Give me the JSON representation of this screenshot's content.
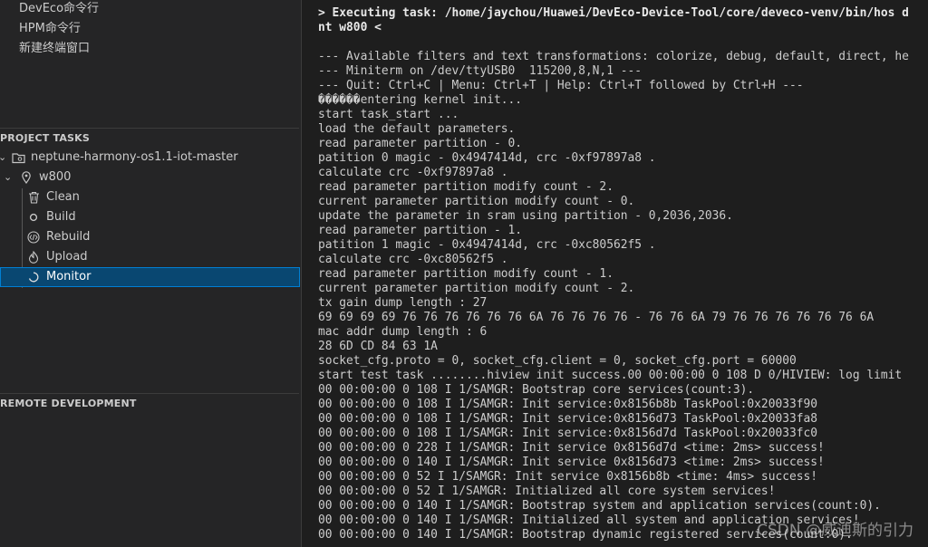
{
  "sidebar": {
    "commands": [
      "DevEco命令行",
      "HPM命令行",
      "新建终端窗口"
    ],
    "project_tasks_header": "PROJECT TASKS",
    "project": {
      "name": "neptune-harmony-os1.1-iot-master",
      "target": "w800",
      "tasks": [
        {
          "label": "Clean",
          "icon": "trash-icon"
        },
        {
          "label": "Build",
          "icon": "circle-icon"
        },
        {
          "label": "Rebuild",
          "icon": "code-icon"
        },
        {
          "label": "Upload",
          "icon": "flame-icon"
        },
        {
          "label": "Monitor",
          "icon": "loading-icon",
          "selected": true
        }
      ]
    },
    "remote_header": "REMOTE DEVELOPMENT"
  },
  "terminal": {
    "lines": [
      {
        "text": "> Executing task: /home/jaychou/Huawei/DevEco-Device-Tool/core/deveco-venv/bin/hos d",
        "bold": true
      },
      {
        "text": "nt w800 <",
        "bold": true
      },
      {
        "text": ""
      },
      {
        "text": "--- Available filters and text transformations: colorize, debug, default, direct, he"
      },
      {
        "text": "--- Miniterm on /dev/ttyUSB0  115200,8,N,1 ---"
      },
      {
        "text": "--- Quit: Ctrl+C | Menu: Ctrl+T | Help: Ctrl+T followed by Ctrl+H ---"
      },
      {
        "text": "������entering kernel init..."
      },
      {
        "text": "start task_start ..."
      },
      {
        "text": "load the default parameters."
      },
      {
        "text": "read parameter partition - 0."
      },
      {
        "text": "patition 0 magic - 0x4947414d, crc -0xf97897a8 ."
      },
      {
        "text": "calculate crc -0xf97897a8 ."
      },
      {
        "text": "read parameter partition modify count - 2."
      },
      {
        "text": "current parameter partition modify count - 0."
      },
      {
        "text": "update the parameter in sram using partition - 0,2036,2036."
      },
      {
        "text": "read parameter partition - 1."
      },
      {
        "text": "patition 1 magic - 0x4947414d, crc -0xc80562f5 ."
      },
      {
        "text": "calculate crc -0xc80562f5 ."
      },
      {
        "text": "read parameter partition modify count - 1."
      },
      {
        "text": "current parameter partition modify count - 2."
      },
      {
        "text": "tx gain dump length : 27"
      },
      {
        "text": "69 69 69 69 76 76 76 76 76 76 6A 76 76 76 76 - 76 76 6A 79 76 76 76 76 76 76 6A"
      },
      {
        "text": "mac addr dump length : 6"
      },
      {
        "text": "28 6D CD 84 63 1A"
      },
      {
        "text": "socket_cfg.proto = 0, socket_cfg.client = 0, socket_cfg.port = 60000"
      },
      {
        "text": "start test task ........hiview init success.00 00:00:00 0 108 D 0/HIVIEW: log limit"
      },
      {
        "text": "00 00:00:00 0 108 I 1/SAMGR: Bootstrap core services(count:3)."
      },
      {
        "text": "00 00:00:00 0 108 I 1/SAMGR: Init service:0x8156b8b TaskPool:0x20033f90"
      },
      {
        "text": "00 00:00:00 0 108 I 1/SAMGR: Init service:0x8156d73 TaskPool:0x20033fa8"
      },
      {
        "text": "00 00:00:00 0 108 I 1/SAMGR: Init service:0x8156d7d TaskPool:0x20033fc0"
      },
      {
        "text": "00 00:00:00 0 228 I 1/SAMGR: Init service 0x8156d7d <time: 2ms> success!"
      },
      {
        "text": "00 00:00:00 0 140 I 1/SAMGR: Init service 0x8156d73 <time: 2ms> success!"
      },
      {
        "text": "00 00:00:00 0 52 I 1/SAMGR: Init service 0x8156b8b <time: 4ms> success!"
      },
      {
        "text": "00 00:00:00 0 52 I 1/SAMGR: Initialized all core system services!"
      },
      {
        "text": "00 00:00:00 0 140 I 1/SAMGR: Bootstrap system and application services(count:0)."
      },
      {
        "text": "00 00:00:00 0 140 I 1/SAMGR: Initialized all system and application services!"
      },
      {
        "text": "00 00:00:00 0 140 I 1/SAMGR: Bootstrap dynamic registered services(count:0)."
      }
    ]
  },
  "watermark": "CSDN @威迪斯的引力",
  "colors": {
    "selected_bg": "#094771",
    "selected_border": "#007fd4",
    "terminal_bg": "#1e1e1e",
    "sidebar_bg": "#252526"
  }
}
